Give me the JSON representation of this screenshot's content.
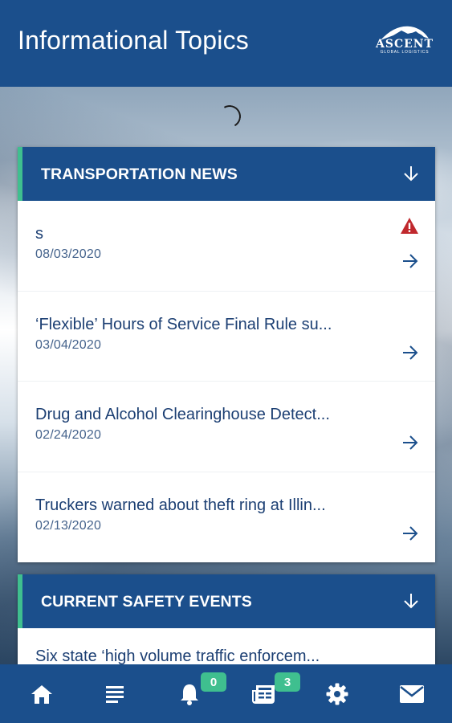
{
  "header": {
    "title": "Informational Topics",
    "logo": {
      "word": "ASCENT",
      "tagline": "GLOBAL LOGISTICS"
    }
  },
  "sections": [
    {
      "title": "TRANSPORTATION NEWS",
      "items": [
        {
          "title": "s",
          "date": "08/03/2020",
          "alert": true
        },
        {
          "title": "‘Flexible’ Hours of Service Final Rule su...",
          "date": "03/04/2020",
          "alert": false
        },
        {
          "title": "Drug and Alcohol Clearinghouse Detect...",
          "date": "02/24/2020",
          "alert": false
        },
        {
          "title": "Truckers warned about theft ring at Illin...",
          "date": "02/13/2020",
          "alert": false
        }
      ]
    },
    {
      "title": "CURRENT SAFETY EVENTS",
      "items": [
        {
          "title": "Six state ‘high volume traffic enforcem..."
        }
      ]
    }
  ],
  "tabbar": {
    "items": [
      {
        "icon": "home-icon"
      },
      {
        "icon": "list-icon"
      },
      {
        "icon": "bell-icon",
        "badge": "0"
      },
      {
        "icon": "newspaper-icon",
        "badge": "3"
      },
      {
        "icon": "gear-icon"
      },
      {
        "icon": "mail-icon"
      }
    ]
  },
  "colors": {
    "primary": "#1b4f8c",
    "accent": "#3fbf8f",
    "text_dark": "#1c3f73",
    "alert": "#c0282d"
  }
}
